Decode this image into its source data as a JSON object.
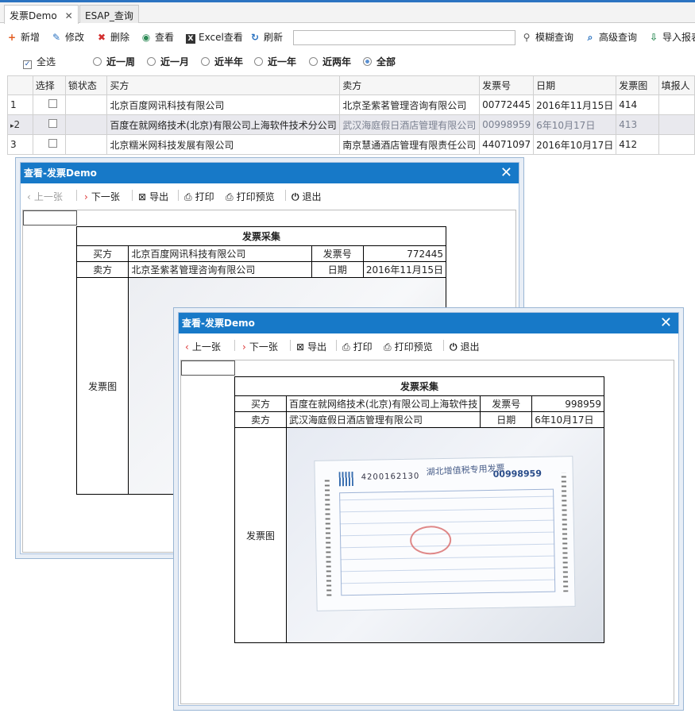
{
  "tabs": [
    {
      "label": "发票Demo",
      "active": true
    },
    {
      "label": "ESAP_查询",
      "active": false
    }
  ],
  "toolbar": {
    "add": "新增",
    "edit": "修改",
    "delete": "删除",
    "view": "查看",
    "excel": "Excel查看",
    "refresh": "刷新",
    "search_value": "",
    "fuzzy": "模糊查询",
    "advanced": "高级查询",
    "import": "导入报表"
  },
  "filters": {
    "select_all": "全选",
    "week": "近一周",
    "month": "近一月",
    "half_year": "近半年",
    "year": "近一年",
    "two_years": "近两年",
    "all": "全部",
    "selected": "全部"
  },
  "grid": {
    "headers": [
      "选择",
      "锁状态",
      "买方",
      "卖方",
      "发票号",
      "日期",
      "发票图",
      "填报人"
    ],
    "rows": [
      {
        "no": "1",
        "buyer": "北京百度网讯科技有限公司",
        "seller": "北京圣紫茗管理咨询有限公司",
        "invoice_no": "00772445",
        "date": "2016年11月15日",
        "img": "414",
        "current": false
      },
      {
        "no": "2",
        "buyer": "百度在就网络技术(北京)有限公司上海软件技术分公司",
        "seller": "武汉海庭假日酒店管理有限公司",
        "invoice_no": "00998959",
        "date": "6年10月17日",
        "img": "413",
        "current": true
      },
      {
        "no": "3",
        "buyer": "北京糯米网科技发展有限公司",
        "seller": "南京慧通酒店管理有限责任公司",
        "invoice_no": "44071097",
        "date": "2016年10月17日",
        "img": "412",
        "current": false
      }
    ]
  },
  "win1": {
    "title": "查看-发票Demo",
    "prev": "上一张",
    "next": "下一张",
    "export": "导出",
    "print": "打印",
    "preview": "打印预览",
    "exit": "退出",
    "report": {
      "title": "发票采集",
      "buyer_label": "买方",
      "buyer": "北京百度网讯科技有限公司",
      "no_label": "发票号",
      "no": "772445",
      "seller_label": "卖方",
      "seller": "北京圣紫茗管理咨询有限公司",
      "date_label": "日期",
      "date": "2016年11月15日",
      "img_label": "发票图"
    }
  },
  "win2": {
    "title": "查看-发票Demo",
    "prev": "上一张",
    "next": "下一张",
    "export": "导出",
    "print": "打印",
    "preview": "打印预览",
    "exit": "退出",
    "report": {
      "title": "发票采集",
      "buyer_label": "买方",
      "buyer": "百度在就网络技术(北京)有限公司上海软件技",
      "no_label": "发票号",
      "no": "998959",
      "seller_label": "卖方",
      "seller": "武汉海庭假日酒店管理有限公司",
      "date_label": "日期",
      "date": "6年10月17日",
      "img_label": "发票图"
    },
    "invoice": {
      "code": "4200162130",
      "header": "湖北增值税专用发票",
      "number": "00998959"
    }
  }
}
